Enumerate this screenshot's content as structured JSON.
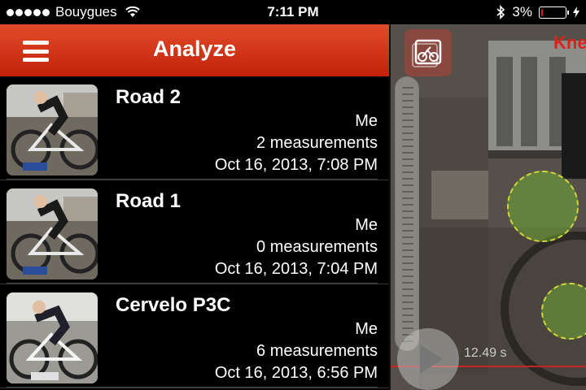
{
  "status_bar": {
    "carrier": "Bouygues",
    "time": "7:11 PM",
    "battery_percent": "3%",
    "battery_level": 0.03,
    "icons": [
      "signal-dots",
      "wifi-icon",
      "bluetooth-icon",
      "battery-icon",
      "charging-bolt-icon"
    ]
  },
  "nav": {
    "title": "Analyze",
    "menu_icon": "hamburger-menu-icon"
  },
  "items": [
    {
      "title": "Road 2",
      "owner": "Me",
      "measurements": "2 measurements",
      "date": "Oct 16, 2013, 7:08 PM"
    },
    {
      "title": "Road 1",
      "owner": "Me",
      "measurements": "0 measurements",
      "date": "Oct 16, 2013, 7:04 PM"
    },
    {
      "title": "Cervelo P3C",
      "owner": "Me",
      "measurements": "6 measurements",
      "date": "Oct 16, 2013, 6:56 PM"
    }
  ],
  "video_panel": {
    "label": "Kne",
    "time_readout": "12.49 s",
    "icons": [
      "bike-camera-icon",
      "play-icon"
    ]
  },
  "colors": {
    "accent": "#d0341a",
    "accent_label": "#e0201a",
    "marker_fill": "#78be32",
    "marker_border": "#d6d63a"
  }
}
